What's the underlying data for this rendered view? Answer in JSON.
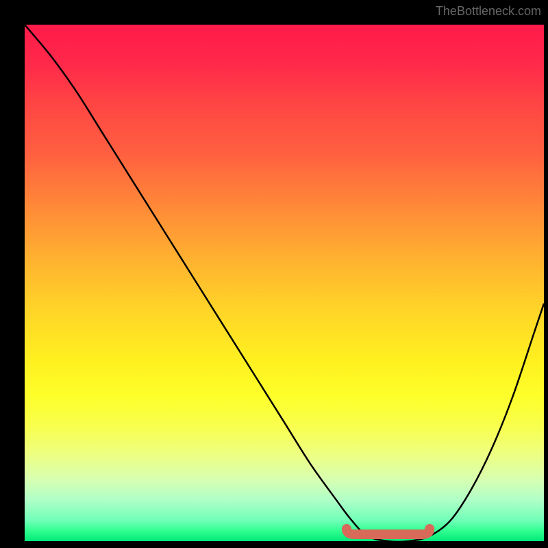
{
  "watermark": "TheBottleneck.com",
  "chart_data": {
    "type": "line",
    "title": "",
    "xlabel": "",
    "ylabel": "",
    "xlim": [
      0,
      100
    ],
    "ylim": [
      0,
      100
    ],
    "x": [
      0,
      5,
      10,
      15,
      20,
      25,
      30,
      35,
      40,
      45,
      50,
      55,
      60,
      63,
      66,
      70,
      74,
      78,
      82,
      86,
      90,
      94,
      98,
      100
    ],
    "values": [
      100,
      94,
      87,
      79,
      71,
      63,
      55,
      47,
      39,
      31,
      23,
      15,
      8,
      4,
      1,
      0,
      0,
      1,
      4,
      10,
      18,
      28,
      40,
      46
    ],
    "optimal_range": {
      "x_start": 62,
      "x_end": 78,
      "y": 0
    },
    "gradient": {
      "top_color": "#ff1a4a",
      "bottom_color": "#00e878",
      "interpretation": "lower values (green) are better"
    }
  }
}
